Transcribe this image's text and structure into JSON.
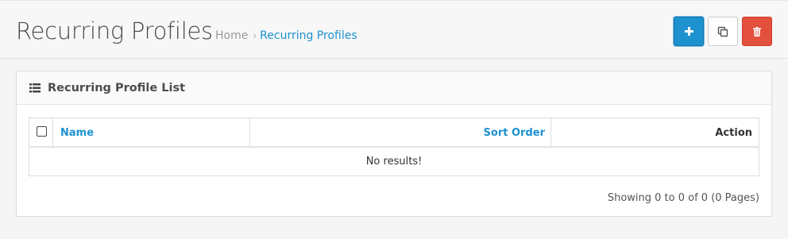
{
  "header": {
    "title": "Recurring Profiles",
    "breadcrumb": {
      "home": "Home",
      "separator": "›",
      "current": "Recurring Profiles"
    },
    "actions": {
      "add_icon": "plus-icon",
      "copy_icon": "copy-icon",
      "delete_icon": "trash-icon"
    }
  },
  "panel": {
    "icon": "list-icon",
    "title": "Recurring Profile List",
    "table": {
      "columns": {
        "name": "Name",
        "sort_order": "Sort Order",
        "action": "Action"
      },
      "empty_message": "No results!"
    },
    "pagination_text": "Showing 0 to 0 of 0 (0 Pages)"
  },
  "colors": {
    "primary": "#1e91cf",
    "danger": "#e3503e",
    "link": "#1e91cf"
  }
}
